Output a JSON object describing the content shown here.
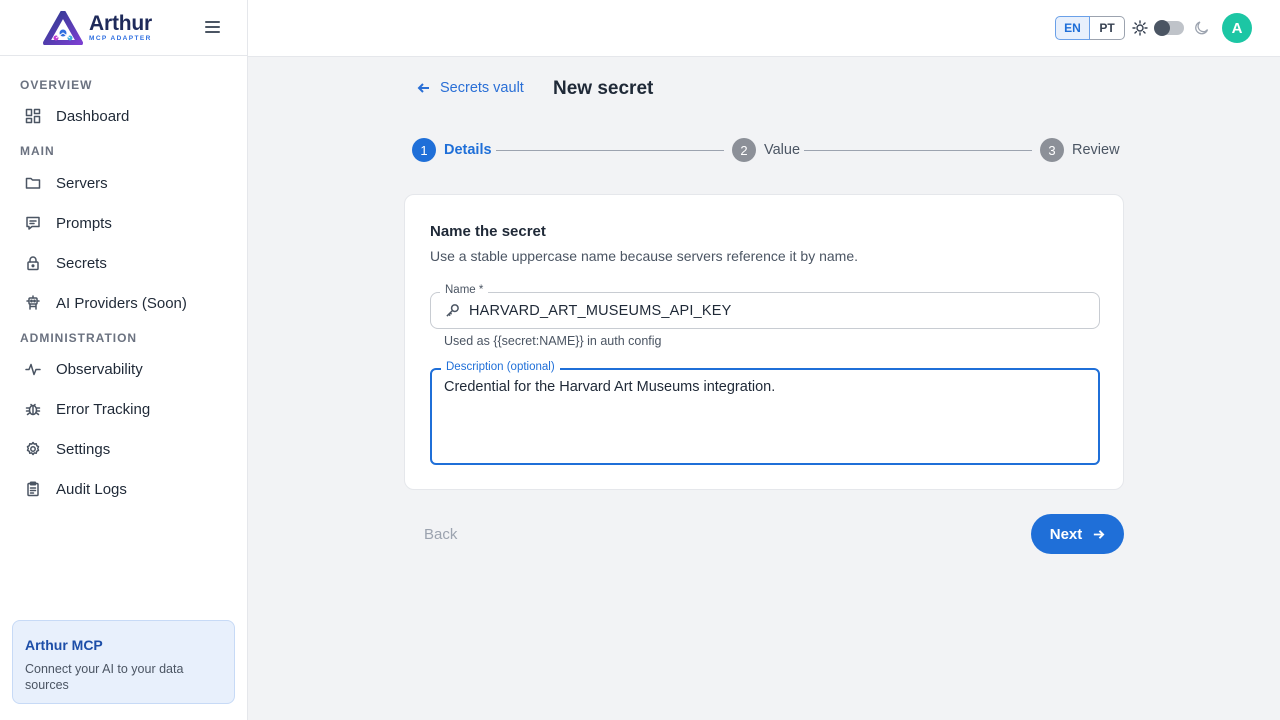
{
  "brand": {
    "name": "Arthur",
    "subtitle": "MCP ADAPTER"
  },
  "sidebar": {
    "sections": [
      {
        "label": "OVERVIEW",
        "items": [
          {
            "label": "Dashboard",
            "icon": "dashboard-icon"
          }
        ]
      },
      {
        "label": "MAIN",
        "items": [
          {
            "label": "Servers",
            "icon": "folder-icon"
          },
          {
            "label": "Prompts",
            "icon": "chat-icon"
          },
          {
            "label": "Secrets",
            "icon": "lock-icon"
          },
          {
            "label": "AI Providers (Soon)",
            "icon": "robot-icon"
          }
        ]
      },
      {
        "label": "ADMINISTRATION",
        "items": [
          {
            "label": "Observability",
            "icon": "activity-icon"
          },
          {
            "label": "Error Tracking",
            "icon": "bug-icon"
          },
          {
            "label": "Settings",
            "icon": "gear-icon"
          },
          {
            "label": "Audit Logs",
            "icon": "clipboard-icon"
          }
        ]
      }
    ],
    "promo": {
      "title": "Arthur MCP",
      "text": "Connect your AI to your data sources"
    }
  },
  "header": {
    "languages": [
      "EN",
      "PT"
    ],
    "active_language": "EN",
    "avatar_initial": "A",
    "theme": "light"
  },
  "main": {
    "back_link": "Secrets vault",
    "title": "New secret",
    "steps": [
      {
        "num": "1",
        "label": "Details",
        "state": "active"
      },
      {
        "num": "2",
        "label": "Value",
        "state": "inactive"
      },
      {
        "num": "3",
        "label": "Review",
        "state": "inactive"
      }
    ],
    "card": {
      "title": "Name the secret",
      "subtitle": "Use a stable uppercase name because servers reference it by name.",
      "name_label": "Name *",
      "name_value": "HARVARD_ART_MUSEUMS_API_KEY",
      "name_helper": "Used as {{secret:NAME}} in auth config",
      "description_label": "Description (optional)",
      "description_value": "Credential for the Harvard Art Museums integration."
    },
    "back_button": "Back",
    "next_button": "Next"
  },
  "colors": {
    "accent": "#1f6fd8",
    "avatar": "#1cc6a4",
    "promo_bg": "#e8f0fc"
  }
}
